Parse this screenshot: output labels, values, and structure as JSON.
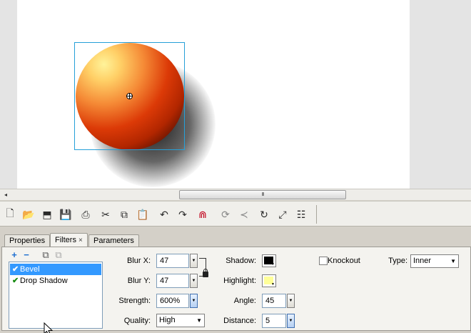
{
  "stage": {
    "object": "ball-with-bevel-and-drop-shadow",
    "colors": {
      "highlight": "#fff39a",
      "mid": "#dc3a07",
      "shadow": "#000000",
      "selection": "#26a0d8"
    }
  },
  "scrollbar": {
    "left_arrow": "◂",
    "thumb_grip": "III"
  },
  "toolbar": {
    "buttons": [
      {
        "name": "new-document-icon",
        "glyph": "🗋"
      },
      {
        "name": "open-folder-icon",
        "glyph": "📂"
      },
      {
        "name": "save-to-server-icon",
        "glyph": "⬒"
      },
      {
        "name": "save-icon",
        "glyph": "💾"
      },
      {
        "name": "print-icon",
        "glyph": "⎙"
      },
      {
        "name": "cut-icon",
        "glyph": "✂"
      },
      {
        "name": "copy-icon",
        "glyph": "⧉"
      },
      {
        "name": "paste-icon",
        "glyph": "📋"
      },
      {
        "name": "undo-icon",
        "glyph": "↶"
      },
      {
        "name": "redo-icon",
        "glyph": "↷"
      },
      {
        "name": "snap-magnet-icon",
        "glyph": "⋒"
      },
      {
        "name": "smooth-icon",
        "glyph": "⟳"
      },
      {
        "name": "straighten-icon",
        "glyph": "≺"
      },
      {
        "name": "rotate-icon",
        "glyph": "↻"
      },
      {
        "name": "scale-icon",
        "glyph": "⤢"
      },
      {
        "name": "align-icon",
        "glyph": "☷"
      }
    ]
  },
  "panel": {
    "tabs": [
      {
        "label": "Properties",
        "active": false
      },
      {
        "label": "Filters",
        "active": true,
        "close": "×"
      },
      {
        "label": "Parameters",
        "active": false
      }
    ],
    "filter_tools": {
      "add": "+",
      "remove": "−",
      "copy": "⧉",
      "paste": "⧉"
    },
    "filters": [
      {
        "label": "Bevel",
        "enabled": true,
        "selected": true
      },
      {
        "label": "Drop Shadow",
        "enabled": true,
        "selected": false
      }
    ],
    "check_glyph": "✔",
    "spin_glyph": "▼",
    "select_glyph": "▼",
    "params": {
      "blur_x": {
        "label": "Blur X:",
        "value": "47"
      },
      "blur_y": {
        "label": "Blur Y:",
        "value": "47"
      },
      "strength": {
        "label": "Strength:",
        "value": "600%"
      },
      "quality": {
        "label": "Quality:",
        "value": "High"
      },
      "shadow": {
        "label": "Shadow:",
        "color": "#000000"
      },
      "highlight": {
        "label": "Highlight:",
        "color": "#ffff99"
      },
      "angle": {
        "label": "Angle:",
        "value": "45"
      },
      "distance": {
        "label": "Distance:",
        "value": "5"
      },
      "knockout": {
        "label": "Knockout",
        "checked": false
      },
      "type": {
        "label": "Type:",
        "value": "Inner"
      }
    }
  }
}
